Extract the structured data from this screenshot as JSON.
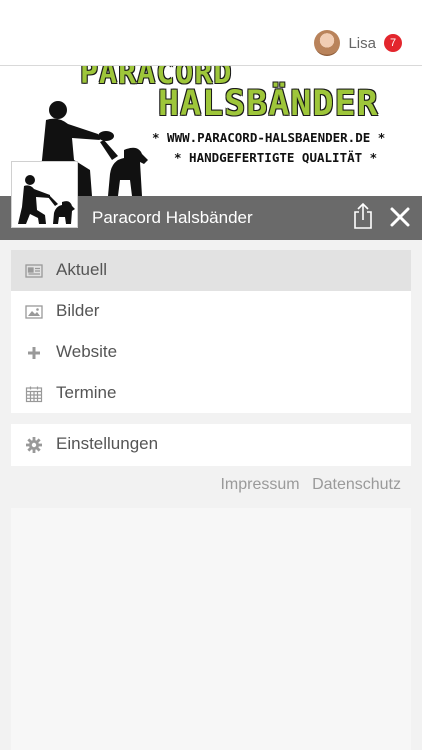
{
  "user": {
    "name": "Lisa",
    "notification_count": "7"
  },
  "banner": {
    "line1": "PARACORD",
    "line2": "HALSBÄNDER",
    "url": "* WWW.PARACORD-HALSBAENDER.DE *",
    "tagline": "* HANDGEFERTIGTE QUALITÄT *"
  },
  "header": {
    "title": "Paracord Halsbänder"
  },
  "menu": {
    "items": [
      {
        "label": "Aktuell",
        "icon": "newspaper-icon"
      },
      {
        "label": "Bilder",
        "icon": "image-icon"
      },
      {
        "label": "Website",
        "icon": "plus-icon"
      },
      {
        "label": "Termine",
        "icon": "calendar-icon"
      }
    ],
    "settings": {
      "label": "Einstellungen",
      "icon": "gear-icon"
    }
  },
  "footer": {
    "impressum": "Impressum",
    "datenschutz": "Datenschutz"
  },
  "colors": {
    "header_bg": "#6a6a6a",
    "active_item_bg": "#e2e2e2",
    "badge": "#e3262d",
    "logo_green": "#9ec63a"
  }
}
